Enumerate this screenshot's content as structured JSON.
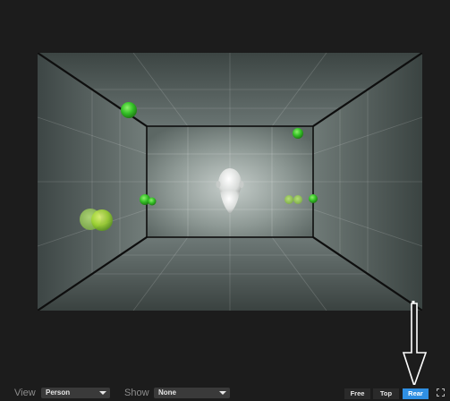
{
  "controls": {
    "view_label": "View",
    "view_value": "Person",
    "show_label": "Show",
    "show_value": "None",
    "buttons": [
      {
        "label": "Free",
        "active": false
      },
      {
        "label": "Top",
        "active": false
      },
      {
        "label": "Rear",
        "active": true
      }
    ]
  },
  "icons": {
    "fullscreen": "fullscreen-icon",
    "listener": "listener-head-icon"
  },
  "colors": {
    "accent": "#2f8fe3",
    "source_green": "#44d633",
    "source_yellow_green": "#9fdb2c"
  }
}
